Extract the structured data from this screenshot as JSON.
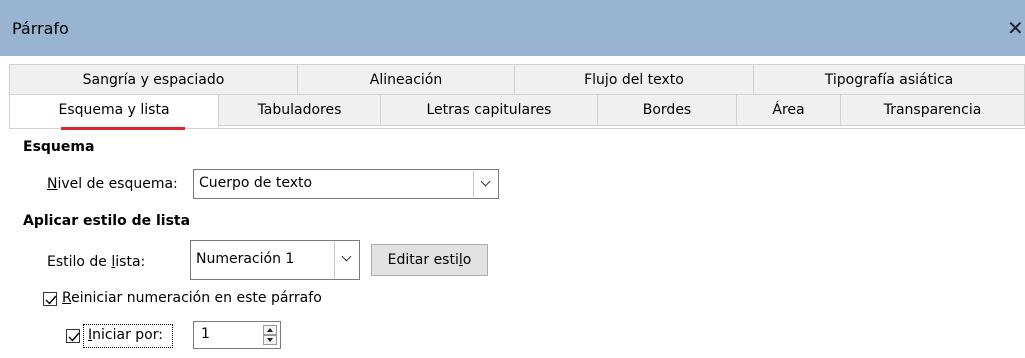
{
  "window": {
    "title": "Párrafo",
    "close_label": "✕"
  },
  "tabs": {
    "back_row": [
      {
        "label": "Sangría y espaciado"
      },
      {
        "label": "Alineación"
      },
      {
        "label": "Flujo del texto"
      },
      {
        "label": "Tipografía asiática"
      }
    ],
    "front_row": [
      {
        "label": "Esquema y lista",
        "active": true
      },
      {
        "label": "Tabuladores"
      },
      {
        "label": "Letras capitulares"
      },
      {
        "label": "Bordes"
      },
      {
        "label": "Área"
      },
      {
        "label": "Transparencia"
      }
    ],
    "accent_color": "#e0242b"
  },
  "outline": {
    "heading": "Esquema",
    "level_label_accel": "N",
    "level_label_rest": "ivel de esquema:",
    "level_value": "Cuerpo de texto"
  },
  "list": {
    "heading": "Aplicar estilo de lista",
    "style_label_pre": "Estilo de ",
    "style_label_accel": "l",
    "style_label_post": "ista:",
    "style_value": "Numeración 1",
    "edit_button_pre": "Editar esti",
    "edit_button_accel": "l",
    "edit_button_post": "o"
  },
  "restart": {
    "checked": true,
    "label_accel": "R",
    "label_rest": "einiciar numeración en este párrafo"
  },
  "start": {
    "checked": true,
    "label_accel": "I",
    "label_rest": "niciar por:",
    "value": "1"
  },
  "colors": {
    "titlebar": "#99b4d1",
    "tab_bg": "#f0f0f0",
    "button_bg": "#e1e1e1"
  }
}
